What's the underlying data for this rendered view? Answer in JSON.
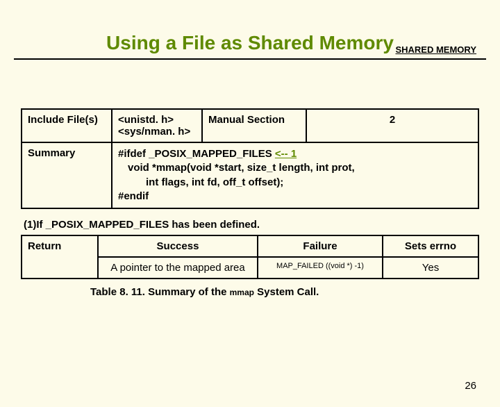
{
  "header": {
    "label": "SHARED MEMORY"
  },
  "title": "Using a File as Shared Memory",
  "table1": {
    "r1c1": "Include File(s)",
    "r1c2_line1": "<unistd. h>",
    "r1c2_line2": "<sys/nman. h>",
    "r1c3": "Manual Section",
    "r1c4": "2",
    "r2c1": "Summary",
    "r2c2_l1": "#ifdef _POSIX_MAPPED_FILES ",
    "r2c2_link": "<-- 1",
    "r2c2_l2": "void *mmap(void *start, size_t length, int prot,",
    "r2c2_l3": "int flags, int fd, off_t offset);",
    "r2c2_l4": "#endif"
  },
  "note": "(1)If _POSIX_MAPPED_FILES has been defined.",
  "table2": {
    "r1c1": "Return",
    "r1c2": "Success",
    "r1c3": "Failure",
    "r1c4": "Sets errno",
    "r2c2": "A pointer to the mapped area",
    "r2c3": "MAP_FAILED ((void *) -1)",
    "r2c4": "Yes"
  },
  "caption_pre": "Table 8. 11. Summary of the ",
  "caption_mono": "mmap",
  "caption_post": " System Call.",
  "page": "26"
}
